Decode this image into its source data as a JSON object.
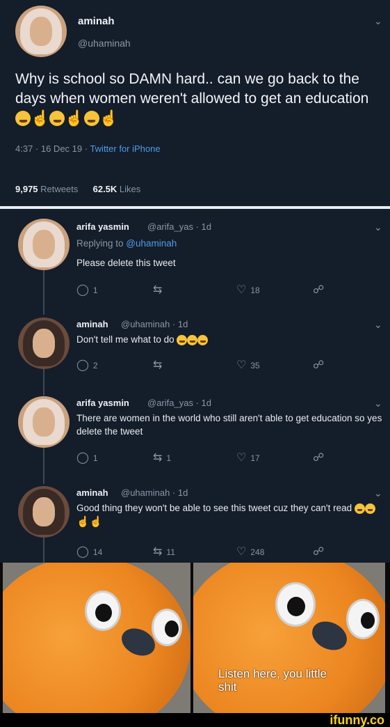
{
  "main_tweet": {
    "name": "aminah",
    "handle": "@uhaminah",
    "text": "Why is school so DAMN hard.. can we go back to the days when women weren't allowed to get an education",
    "emoji_count": 6,
    "time": "4:37 · 16 Dec 19 · ",
    "source": "Twitter for iPhone",
    "retweets_value": "9,975",
    "retweets_label": " Retweets",
    "likes_value": "62.5K",
    "likes_label": " Likes"
  },
  "replies": [
    {
      "name": "arifa yasmin",
      "handle": "@arifa_yas · 1d",
      "replying_prefix": "Replying to ",
      "replying_to": "@uhaminah",
      "text": "Please delete this tweet",
      "replies": "1",
      "retweets": "",
      "likes": "18"
    },
    {
      "name": "aminah",
      "handle": "@uhaminah · 1d",
      "text": "Don't tell me what to do",
      "replies": "2",
      "retweets": "",
      "likes": "35"
    },
    {
      "name": "arifa yasmin",
      "handle": "@arifa_yas · 1d",
      "text": "There are women in the world who still aren't able to get education so yes delete the tweet",
      "replies": "1",
      "retweets": "1",
      "likes": "17"
    },
    {
      "name": "aminah",
      "handle": "@uhaminah · 1d",
      "text": "Good thing they won't be able to see this tweet cuz they can't read",
      "replies": "14",
      "retweets": "11",
      "likes": "248"
    }
  ],
  "meme": {
    "caption": "Listen here, you little shit"
  },
  "watermark": "ifunny.co",
  "colors": {
    "background": "#141d2a",
    "link": "#4d9ee7",
    "muted": "#8796a5",
    "bird_orange": "#ec8620",
    "brand_yellow": "#ffd21e"
  },
  "icons": [
    "reply-icon",
    "retweet-icon",
    "like-icon",
    "share-icon",
    "chevron-down-icon"
  ]
}
